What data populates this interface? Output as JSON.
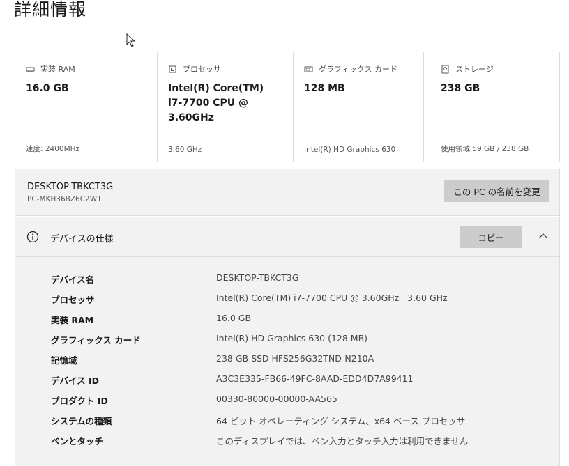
{
  "page": {
    "title": "詳細情報"
  },
  "cards": [
    {
      "icon": "memory-icon",
      "label": "実装 RAM",
      "value": "16.0 GB",
      "foot": "速度: 2400MHz"
    },
    {
      "icon": "processor-icon",
      "label": "プロセッサ",
      "value": "Intel(R) Core(TM)\ni7-7700 CPU @\n3.60GHz",
      "foot": "3.60 GHz"
    },
    {
      "icon": "graphics-card-icon",
      "label": "グラフィックス カード",
      "value": "128 MB",
      "foot": "Intel(R) HD Graphics 630"
    },
    {
      "icon": "storage-icon",
      "label": "ストレージ",
      "value": "238 GB",
      "foot": "使用領域 59 GB / 238 GB"
    }
  ],
  "device": {
    "name": "DESKTOP-TBKCT3G",
    "model": "PC-MKH36BZ6C2W1",
    "rename_label": "この PC の名前を変更"
  },
  "specs": {
    "title": "デバイスの仕様",
    "copy_label": "コピー",
    "rows": [
      {
        "label": "デバイス名",
        "value": "DESKTOP-TBKCT3G"
      },
      {
        "label": "プロセッサ",
        "value": "Intel(R) Core(TM) i7-7700 CPU @ 3.60GHz   3.60 GHz"
      },
      {
        "label": "実装 RAM",
        "value": "16.0 GB"
      },
      {
        "label": "グラフィックス カード",
        "value": "Intel(R) HD Graphics 630 (128 MB)"
      },
      {
        "label": "記憶域",
        "value": "238 GB SSD HFS256G32TND-N210A"
      },
      {
        "label": "デバイス ID",
        "value": "A3C3E335-FB66-49FC-8AAD-EDD4D7A99411"
      },
      {
        "label": "プロダクト ID",
        "value": "00330-80000-00000-AA565"
      },
      {
        "label": "システムの種類",
        "value": "64 ビット オペレーティング システム、x64 ベース プロセッサ"
      },
      {
        "label": "ペンとタッチ",
        "value": "このディスプレイでは、ペン入力とタッチ入力は利用できません"
      }
    ]
  }
}
